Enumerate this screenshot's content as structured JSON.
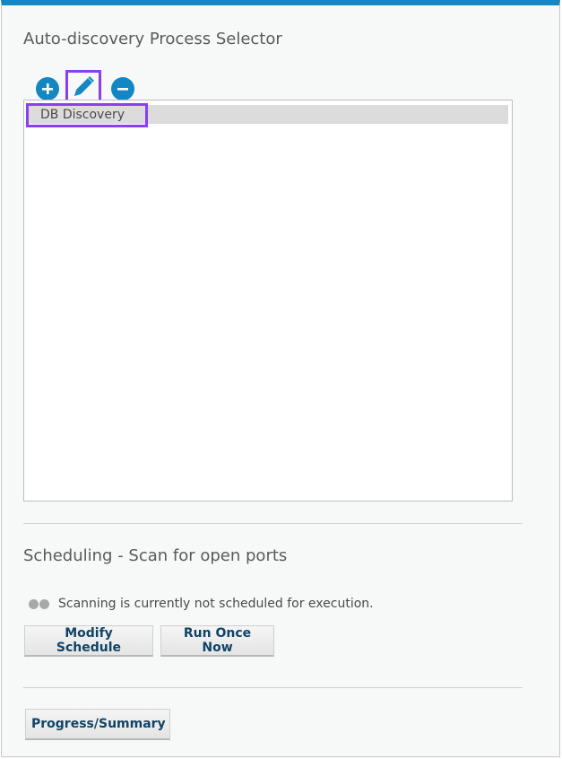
{
  "selector": {
    "title": "Auto-discovery Process Selector",
    "toolbar": {
      "add_icon": "plus-circle-icon",
      "edit_icon": "pencil-icon",
      "remove_icon": "minus-circle-icon"
    },
    "items": [
      {
        "label": "DB Discovery"
      }
    ]
  },
  "scheduling": {
    "title": "Scheduling - Scan for open ports",
    "status_text": "Scanning is currently not scheduled for execution.",
    "modify_label": "Modify Schedule",
    "run_label": "Run Once Now"
  },
  "footer": {
    "progress_label": "Progress/Summary"
  },
  "colors": {
    "accent": "#1387c2",
    "highlight": "#8a3ff0",
    "button_text": "#0f4466"
  }
}
